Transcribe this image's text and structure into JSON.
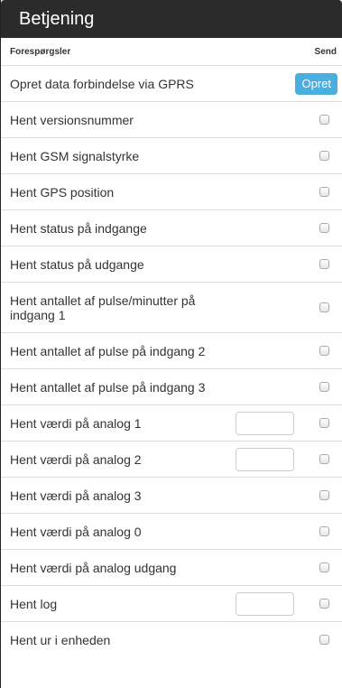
{
  "panel": {
    "title": "Betjening",
    "col_left": "Forespørgsler",
    "col_right": "Send"
  },
  "rows": [
    {
      "label": "Opret data forbindelse via GPRS",
      "button": "Opret"
    },
    {
      "label": "Hent versionsnummer"
    },
    {
      "label": "Hent GSM signalstyrke"
    },
    {
      "label": "Hent GPS position"
    },
    {
      "label": "Hent status på indgange"
    },
    {
      "label": "Hent status på udgange"
    },
    {
      "label": "Hent antallet af pulse/minutter på indgang 1"
    },
    {
      "label": "Hent antallet af pulse på indgang 2"
    },
    {
      "label": "Hent antallet af pulse på indgang 3"
    },
    {
      "label": "Hent værdi på analog 1",
      "input_value": ""
    },
    {
      "label": "Hent værdi på analog 2",
      "input_value": ""
    },
    {
      "label": "Hent værdi på analog 3"
    },
    {
      "label": "Hent værdi på analog 0"
    },
    {
      "label": "Hent værdi på analog udgang"
    },
    {
      "label": "Hent log",
      "input_value": ""
    },
    {
      "label": "Hent ur i enheden"
    }
  ]
}
